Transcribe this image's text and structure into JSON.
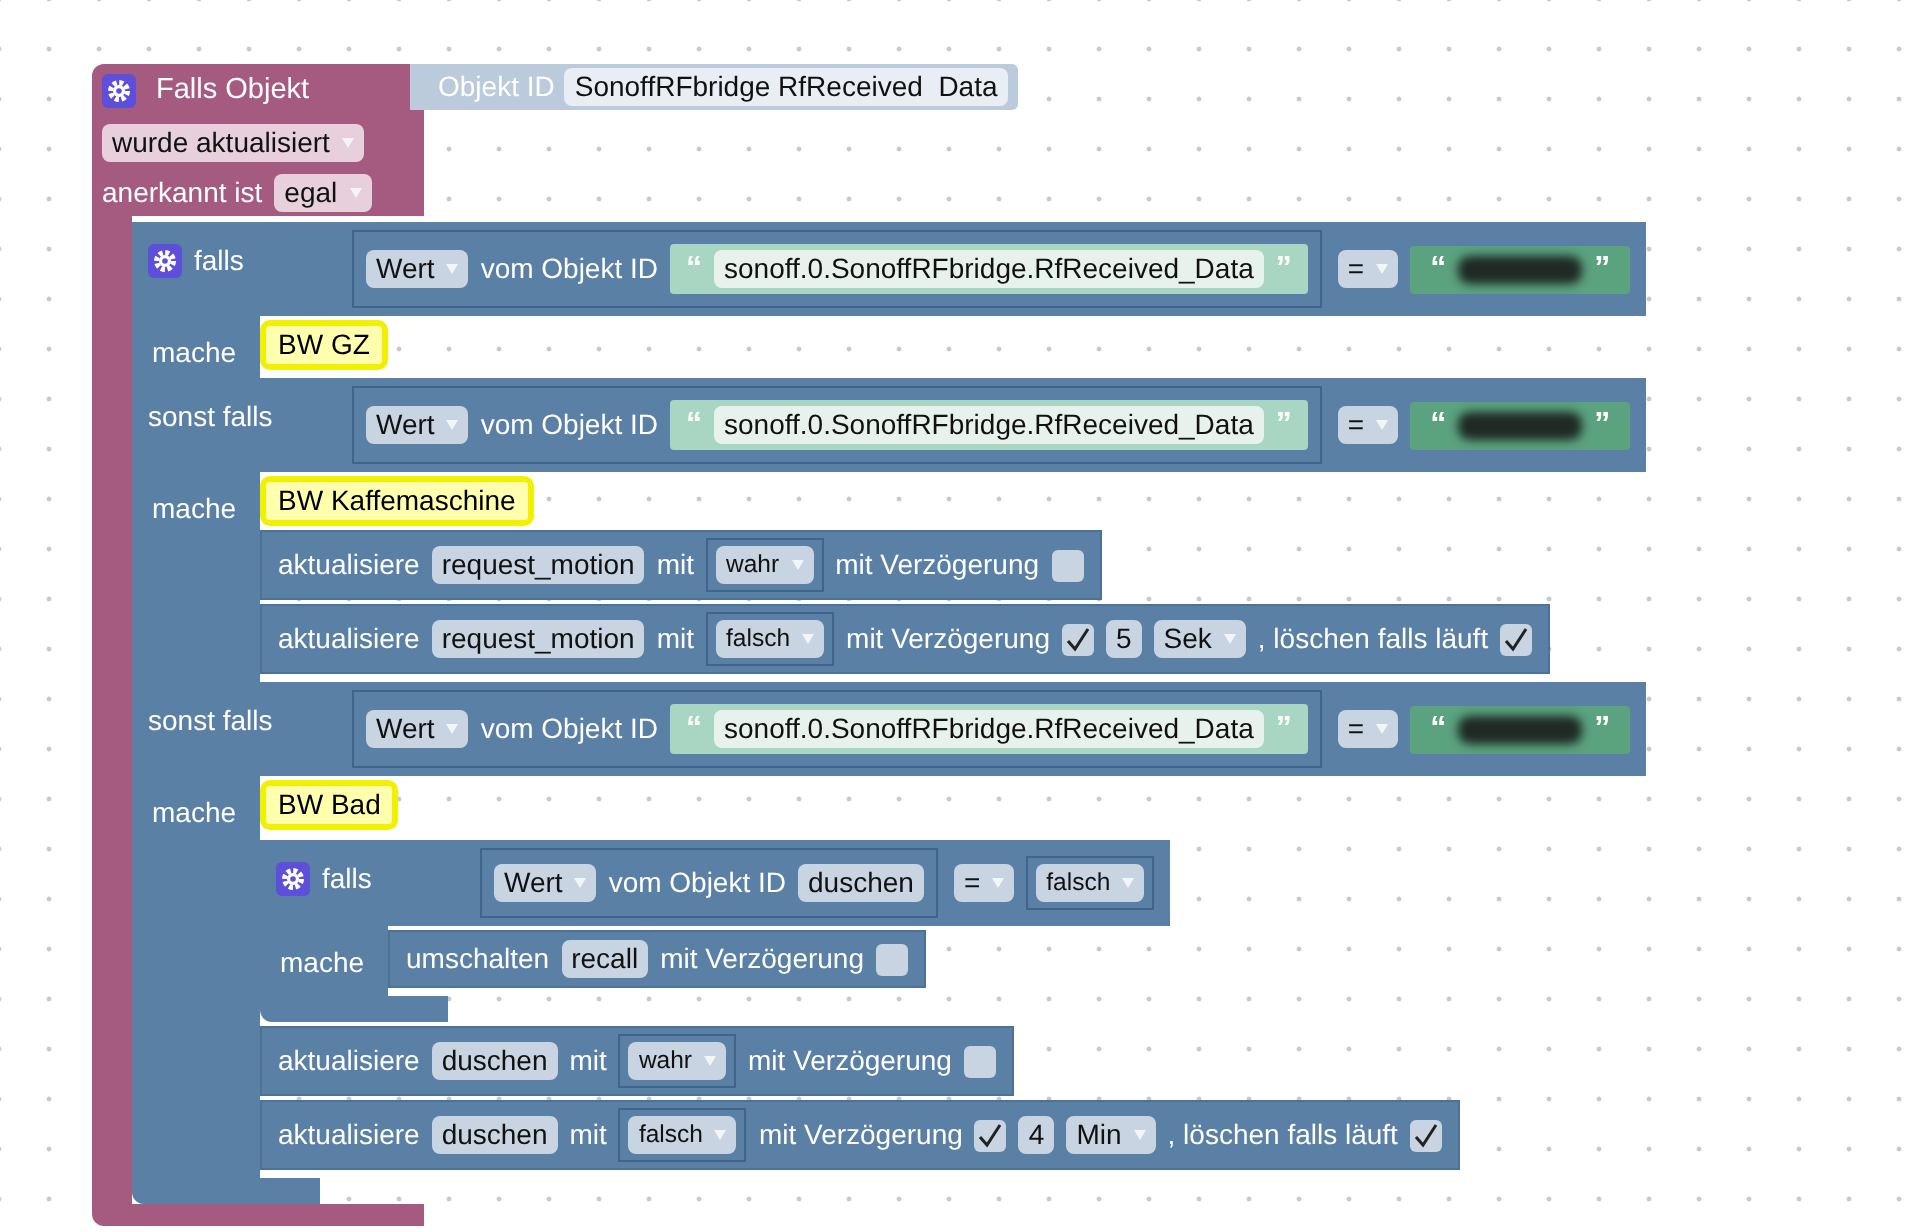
{
  "event_block": {
    "title": "Falls Objekt",
    "object_label": "Objekt ID",
    "object_id": "SonoffRFbridge RfReceived  Data",
    "trigger": "wurde aktualisiert",
    "ack_label": "anerkannt ist",
    "ack": "egal",
    "statements": [
      {
        "kind": "if",
        "branches": [
          {
            "label": "falls",
            "do_label": "mache",
            "condition": {
              "source": "Wert",
              "source_label": "vom Objekt ID",
              "object": {
                "kind": "string",
                "open_quote": "“",
                "text": "sonoff.0.SonoffRFbridge.RfReceived_Data",
                "close_quote": "”"
              },
              "operator": "=",
              "compare": {
                "kind": "redacted",
                "open_quote": "“",
                "close_quote": "”"
              }
            },
            "statements": [
              {
                "kind": "comment",
                "text": "BW GZ"
              }
            ]
          },
          {
            "label": "sonst falls",
            "do_label": "mache",
            "condition": {
              "source": "Wert",
              "source_label": "vom Objekt ID",
              "object": {
                "kind": "string",
                "open_quote": "“",
                "text": "sonoff.0.SonoffRFbridge.RfReceived_Data",
                "close_quote": "”"
              },
              "operator": "=",
              "compare": {
                "kind": "redacted",
                "open_quote": "“",
                "close_quote": "”"
              }
            },
            "statements": [
              {
                "kind": "comment",
                "text": "BW Kaffemaschine"
              },
              {
                "kind": "update",
                "verb": "aktualisiere",
                "object": "request_motion",
                "with_label": "mit",
                "value": "wahr",
                "delay_label": "mit Verzögerung",
                "delay": false
              },
              {
                "kind": "update",
                "verb": "aktualisiere",
                "object": "request_motion",
                "with_label": "mit",
                "value": "falsch",
                "delay_label": "mit Verzögerung",
                "delay": true,
                "delay_value": "5",
                "unit": "Sek",
                "clear_label": ", löschen falls läuft",
                "clear": true
              }
            ]
          },
          {
            "label": "sonst falls",
            "do_label": "mache",
            "condition": {
              "source": "Wert",
              "source_label": "vom Objekt ID",
              "object": {
                "kind": "string",
                "open_quote": "“",
                "text": "sonoff.0.SonoffRFbridge.RfReceived_Data",
                "close_quote": "”"
              },
              "operator": "=",
              "compare": {
                "kind": "redacted",
                "open_quote": "“",
                "close_quote": "”"
              }
            },
            "statements": [
              {
                "kind": "comment",
                "text": "BW Bad"
              },
              {
                "kind": "if",
                "branches": [
                  {
                    "label": "falls",
                    "do_label": "mache",
                    "condition": {
                      "source": "Wert",
                      "source_label": "vom Objekt ID",
                      "object": {
                        "kind": "field",
                        "text": "duschen"
                      },
                      "operator": "=",
                      "compare": {
                        "kind": "dropdown",
                        "text": "falsch"
                      }
                    },
                    "statements": [
                      {
                        "kind": "toggle",
                        "verb": "umschalten",
                        "object": "recall",
                        "delay_label": "mit Verzögerung",
                        "delay": false
                      }
                    ]
                  }
                ]
              },
              {
                "kind": "update",
                "verb": "aktualisiere",
                "object": "duschen",
                "with_label": "mit",
                "value": "wahr",
                "delay_label": "mit Verzögerung",
                "delay": false
              },
              {
                "kind": "update",
                "verb": "aktualisiere",
                "object": "duschen",
                "with_label": "mit",
                "value": "falsch",
                "delay_label": "mit Verzögerung",
                "delay": true,
                "delay_value": "4",
                "unit": "Min",
                "clear_label": ", löschen falls läuft",
                "clear": true
              }
            ]
          }
        ]
      }
    ]
  }
}
